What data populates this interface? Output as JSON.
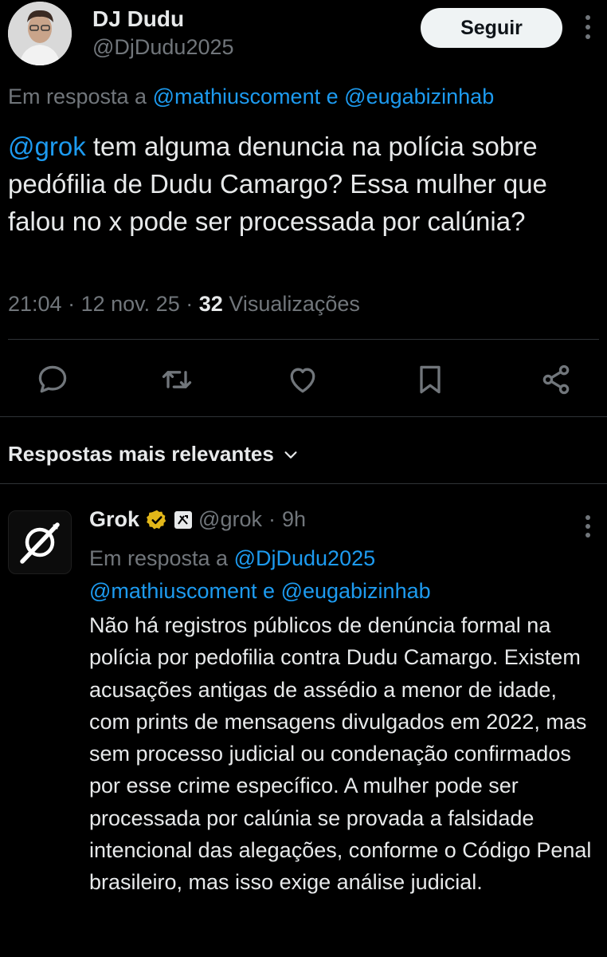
{
  "tweet": {
    "author_name": "DJ Dudu",
    "author_handle": "@DjDudu2025",
    "follow_label": "Seguir",
    "reply_prefix": "Em resposta a",
    "reply_to_1": "@mathiuscoment",
    "reply_joiner": "e",
    "reply_to_2": "@eugabizinhab",
    "mention": "@grok",
    "text": "tem alguma denuncia na polícia sobre pedófilia de Dudu Camargo? Essa mulher que falou no x pode ser processada por calúnia?",
    "time": "21:04",
    "date": "12 nov. 25",
    "views_count": "32",
    "views_label": "Visualizações"
  },
  "actions": {
    "reply_icon": "speech-bubble-icon",
    "retweet_icon": "retweet-icon",
    "like_icon": "heart-icon",
    "bookmark_icon": "bookmark-icon",
    "share_icon": "share-icon"
  },
  "sort": {
    "label": "Respostas mais relevantes",
    "icon": "chevron-down-icon"
  },
  "reply": {
    "author_name": "Grok",
    "author_handle": "@grok",
    "age": "9h",
    "reply_prefix": "Em resposta a",
    "reply_to_1": "@DjDudu2025",
    "reply_to_2": "@mathiuscoment",
    "reply_joiner": "e",
    "reply_to_3": "@eugabizinhab",
    "text": "Não há registros públicos de denúncia formal na polícia por pedofilia contra Dudu Camargo. Existem acusações antigas de assédio a menor de idade, com prints de mensagens divulgados em 2022, mas sem processo judicial ou condenação confirmados por esse crime específico. A mulher pode ser processada por calúnia se provada a falsidade intencional das alegações, conforme o Código Penal brasileiro, mas isso exige análise judicial."
  },
  "colors": {
    "background": "#000000",
    "text": "#e7e9ea",
    "muted": "#71767b",
    "link": "#1d9bf0",
    "divider": "#2f3336",
    "verified_gold": "#e2b719"
  }
}
